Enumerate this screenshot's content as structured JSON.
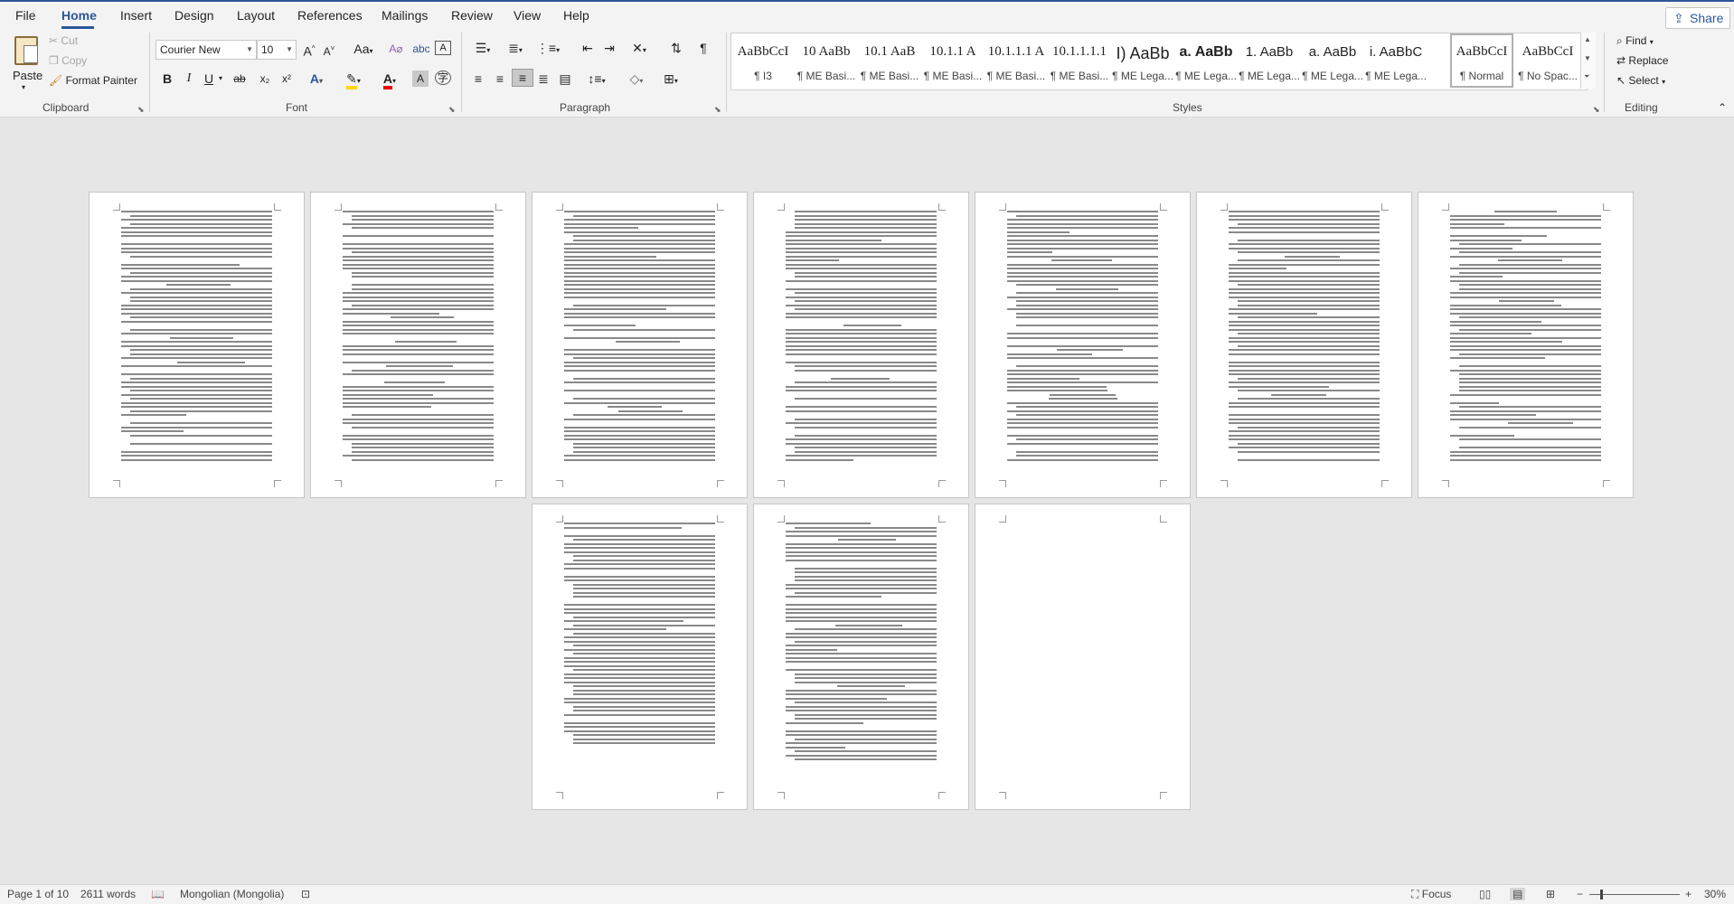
{
  "tabs": [
    "File",
    "Home",
    "Insert",
    "Design",
    "Layout",
    "References",
    "Mailings",
    "Review",
    "View",
    "Help"
  ],
  "share_label": "Share",
  "clipboard": {
    "paste": "Paste",
    "cut": "Cut",
    "copy": "Copy",
    "format_painter": "Format Painter",
    "group": "Clipboard"
  },
  "font": {
    "name": "Courier New",
    "size": "10",
    "group": "Font",
    "bold": "B",
    "italic": "I",
    "underline": "U",
    "strike": "ab",
    "subscript": "x₂",
    "superscript": "x²",
    "case": "Aa"
  },
  "paragraph": {
    "group": "Paragraph"
  },
  "styles": {
    "group": "Styles",
    "items": [
      {
        "preview": "AaBbCcI",
        "name": "¶ I3"
      },
      {
        "preview": "10  AaBb",
        "name": "¶ ME Basi..."
      },
      {
        "preview": "10.1  AaB",
        "name": "¶ ME Basi..."
      },
      {
        "preview": "10.1.1  A",
        "name": "¶ ME Basi..."
      },
      {
        "preview": "10.1.1.1  A",
        "name": "¶ ME Basi..."
      },
      {
        "preview": "10.1.1.1.1",
        "name": "¶ ME Basi..."
      },
      {
        "preview": "I)  AaBb",
        "name": "¶ ME Lega..."
      },
      {
        "preview": "a.  AaBb",
        "name": "¶ ME Lega..."
      },
      {
        "preview": "1.  AaBb",
        "name": "¶ ME Lega..."
      },
      {
        "preview": "a.  AaBb",
        "name": "¶ ME Lega..."
      },
      {
        "preview": "i.  AaBbC",
        "name": "¶ ME Lega..."
      },
      {
        "preview": "AaBbCcI",
        "name": "¶ Normal"
      },
      {
        "preview": "AaBbCcI",
        "name": "¶ No Spac..."
      }
    ]
  },
  "editing": {
    "group": "Editing",
    "find": "Find",
    "replace": "Replace",
    "select": "Select"
  },
  "status": {
    "page": "Page 1 of 10",
    "words": "2611 words",
    "language": "Mongolian (Mongolia)",
    "focus": "Focus",
    "zoom": "30%"
  }
}
